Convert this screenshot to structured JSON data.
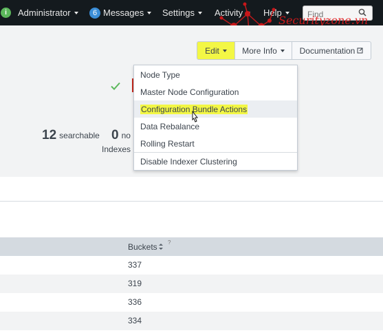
{
  "topbar": {
    "info_badge": "i",
    "user_label": "Administrator",
    "messages_count": "6",
    "messages_label": "Messages",
    "settings_label": "Settings",
    "activity_label": "Activity",
    "help_label": "Help",
    "find_placeholder": "Find",
    "watermark": "Securityzone.vn"
  },
  "toolbar": {
    "edit_label": "Edit",
    "more_info_label": "More Info",
    "documentation_label": "Documentation"
  },
  "summary": {
    "searchable_count": "12",
    "searchable_label": "searchable",
    "not_searchable_count": "0",
    "not_searchable_label": "no",
    "indexes_label": "Indexes"
  },
  "edit_menu": {
    "items": [
      "Node Type",
      "Master Node Configuration",
      "Configuration Bundle Actions",
      "Data Rebalance",
      "Rolling Restart",
      "Disable Indexer Clustering"
    ],
    "highlighted_index": 2
  },
  "table": {
    "column_header": "Buckets",
    "header_info": "?",
    "rows": [
      "337",
      "319",
      "336",
      "334"
    ]
  },
  "colors": {
    "highlight": "#f3f745",
    "topbar": "#141a1e",
    "success": "#5cb85c",
    "error": "#c8271b",
    "badge": "#3b8ed8"
  }
}
